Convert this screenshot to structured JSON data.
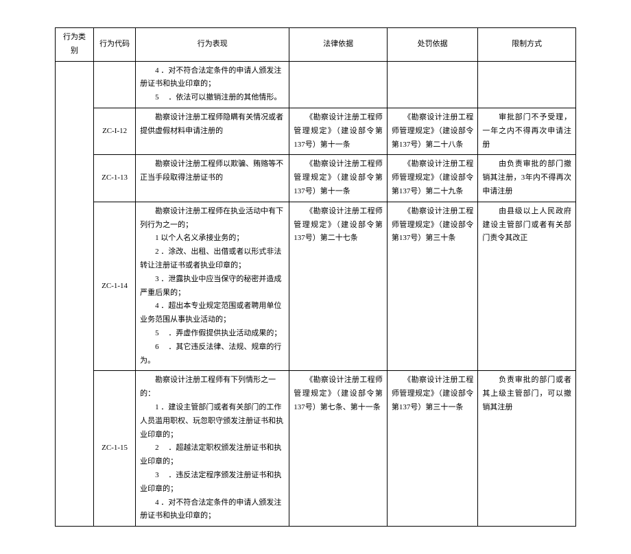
{
  "headers": {
    "category": "行为类别",
    "code": "行为代码",
    "behavior": "行为表现",
    "legal": "法律依据",
    "punish": "处罚依据",
    "limit": "限制方式"
  },
  "rows": [
    {
      "code": "",
      "behavior_lines": [
        "　　4 ．对不符合法定条件的申请人颁发注册证书和执业印章的；",
        "　　5 　．依法可以撤销注册的其他情形。"
      ],
      "legal": "",
      "punish": "",
      "limit": ""
    },
    {
      "code": "ZC-I-12",
      "behavior_lines": [
        "　　勘察设计注册工程师隐瞒有关情况或者提供虚假材料申请注册的"
      ],
      "legal": "　　《勘察设计注册工程师管理规定》（建设部令第137号）第十一条",
      "punish": "　　《勘察设计注册工程师管理规定》（建设部令第137号）第二十八条",
      "limit": "　　审批部门不予受理，一年之内不得再次申请注册"
    },
    {
      "code": "ZC-1-13",
      "behavior_lines": [
        "　　勘察设计注册工程师以欺骗、贿赂等不正当手段取得注册证书的"
      ],
      "legal": "　　《勘察设计注册工程师管理规定》（建设部令第137号）第十一条",
      "punish": "　　《勘察设计注册工程师管理规定》（建设部令第137号）第二十九条",
      "limit": "　　由负责审批的部门撤销其注册，3年内不得再次申请注册"
    },
    {
      "code": "ZC-1-14",
      "behavior_lines": [
        "　　勘察设计注册工程师在执业活动中有下列行为之一的；",
        "　　1 以个人名义承接业务的；",
        "　　2 ．涂改、出租、出借或者以形式非法转让注册证书或者执业印章的；",
        "　　3 ．泄露执业中应当保守的秘密并造成严重后果的；",
        "　　4 ．超出本专业规定范围或者聘用单位业务范围从事执业活动的；",
        "　　5 　．弄虚作假提供执业活动成果的；",
        "　　6 　．其它违反法律、法规、规章的行为。"
      ],
      "legal": "　　《勘察设计注册工程师管理规定》（建设部令第137号）第二十七条",
      "punish": "　　《勘察设计注册工程师管理规定》（建设部令第137号）第三十条",
      "limit": "　　由县级以上人民政府建设主管部门或者有关部门责令其改正"
    },
    {
      "code": "ZC-1-15",
      "behavior_lines": [
        "　　勘察设计注册工程师有下列情形之一的：",
        "　　1 ．建设主管部门或者有关部门的工作人员滥用职权、玩忽职守颁发注册证书和执业印章的；",
        "　　2 　．超越法定职权颁发注册证书和执业印章的；",
        "　　3 　．违反法定程序颁发注册证书和执业印章的；",
        "　　4 ．对不符合法定条件的申请人颁发注册证书和执业印章的；"
      ],
      "legal": "　　《勘察设计注册工程师管理规定》（建设部令第137号）第七条、第十一条",
      "punish": "　　《勘察设计注册工程师管理规定》（建设部令第137号）第三十一条",
      "limit": "　　负责审批的部门或者其上级主管部门，可以撤销其注册"
    }
  ]
}
